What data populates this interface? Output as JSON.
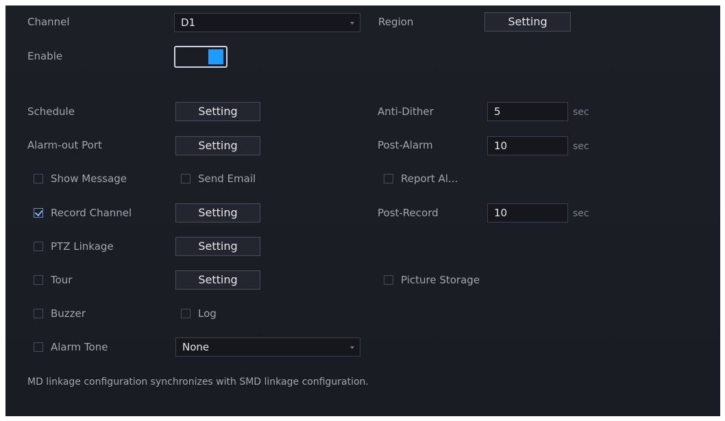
{
  "channel": {
    "label": "Channel",
    "value": "D1"
  },
  "region": {
    "label": "Region",
    "button": "Setting"
  },
  "enable": {
    "label": "Enable",
    "on": true
  },
  "schedule": {
    "label": "Schedule",
    "button": "Setting"
  },
  "alarm_out": {
    "label": "Alarm-out Port",
    "button": "Setting"
  },
  "anti_dither": {
    "label": "Anti-Dither",
    "value": "5",
    "unit": "sec"
  },
  "post_alarm": {
    "label": "Post-Alarm",
    "value": "10",
    "unit": "sec"
  },
  "show_message": {
    "label": "Show Message",
    "checked": false
  },
  "send_email": {
    "label": "Send Email",
    "checked": false
  },
  "report_alarm": {
    "label": "Report Al...",
    "checked": false
  },
  "record_channel": {
    "label": "Record Channel",
    "checked": true,
    "button": "Setting"
  },
  "post_record": {
    "label": "Post-Record",
    "value": "10",
    "unit": "sec"
  },
  "ptz_linkage": {
    "label": "PTZ Linkage",
    "checked": false,
    "button": "Setting"
  },
  "tour": {
    "label": "Tour",
    "checked": false,
    "button": "Setting"
  },
  "picture_storage": {
    "label": "Picture Storage",
    "checked": false
  },
  "buzzer": {
    "label": "Buzzer",
    "checked": false
  },
  "log": {
    "label": "Log",
    "checked": false
  },
  "alarm_tone": {
    "label": "Alarm Tone",
    "checked": false,
    "value": "None"
  },
  "note": "MD linkage configuration synchronizes with SMD linkage configuration.",
  "colors": {
    "background": "#1b1d24",
    "accent": "#1e9bff",
    "text": "#a3a6ad"
  },
  "icons": {
    "dropdown": "chevron-down-icon",
    "check": "checkmark-icon"
  }
}
